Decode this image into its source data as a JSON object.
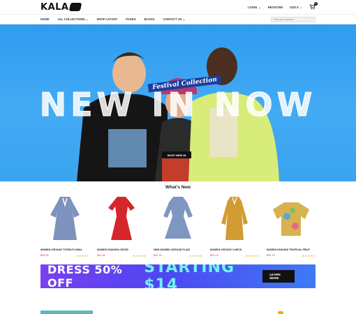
{
  "header": {
    "logo_text": "KALA",
    "login": "LOGIN",
    "register": "REGISTER",
    "currency": "USD $",
    "cart_count": "0"
  },
  "nav": {
    "items": [
      "HOME",
      "ALL COLLECTIONS",
      "SHOP LAYOUT",
      "PAGES",
      "BLOGS",
      "CONTACT US"
    ],
    "active": "HOME",
    "search_placeholder": "Enter your keyword..."
  },
  "hero": {
    "tagline": "Festival Collection",
    "headline": "NEW IN NOW",
    "button": "SHOP NEW IN"
  },
  "whats_new": {
    "title": "What's New",
    "products": [
      {
        "name": "WOMEN VINTAGE TOTEM FLORAL",
        "price": "$34.56",
        "stars": "★★★★★",
        "color": "#7d92bd"
      },
      {
        "name": "WOMEN FASHION CROSS",
        "price": "$31.06",
        "stars": "★★★★★",
        "color": "#d5262b"
      },
      {
        "name": "NEW WOMEN VINTAGE PLAID",
        "price": "$32.76",
        "stars": "★★★★★",
        "color": "#7f96c1"
      },
      {
        "name": "WOMEN VINTAGE V-NECK",
        "price": "$32.13",
        "stars": "★★★★★",
        "color": "#d39b34"
      },
      {
        "name": "WOMEN FASHION TROPICAL FRUIT",
        "price": "$22.76",
        "stars": "★★★★★",
        "color": "#d8b24f"
      }
    ]
  },
  "promo": {
    "left": "DRESS 50% OFF",
    "right": "STARTING $14",
    "button": "LEARN MORE"
  }
}
